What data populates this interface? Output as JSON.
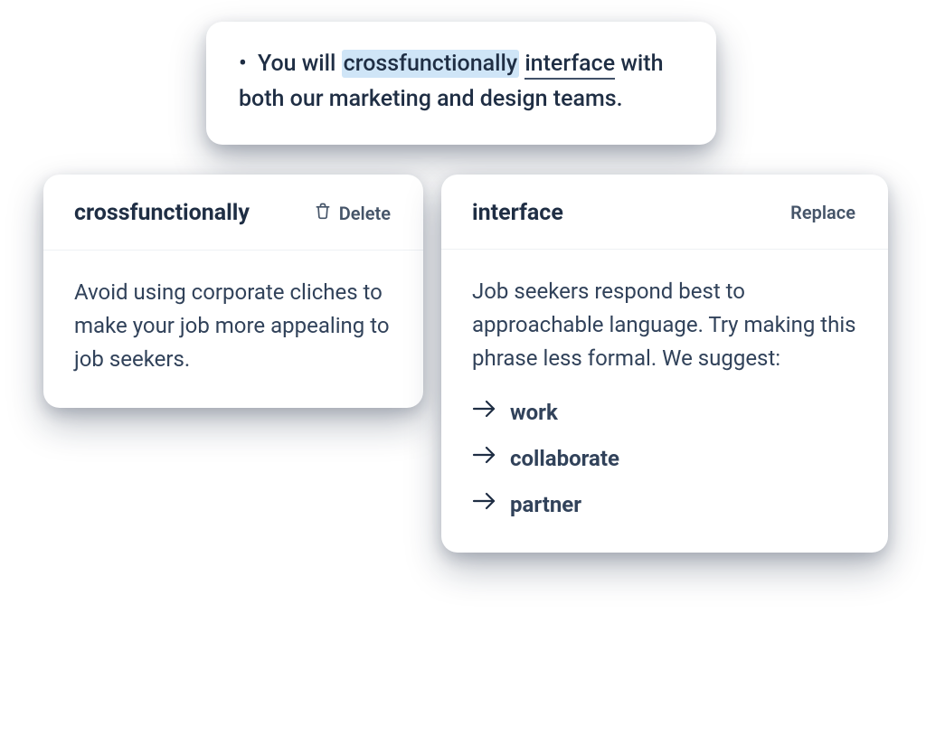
{
  "sentence": {
    "bullet": "•",
    "part1": "You will ",
    "highlighted": "crossfunctionally",
    "space": " ",
    "underlined": "interface",
    "part2": " with both our marketing and design teams."
  },
  "cards": {
    "left": {
      "title": "crossfunctionally",
      "action": "Delete",
      "body": "Avoid using corporate cliches to make your job more appealing to job seekers."
    },
    "right": {
      "title": "interface",
      "action": "Replace",
      "body": "Job seekers respond best to approachable language. Try making this phrase less formal. We suggest:",
      "suggestions": [
        "work",
        "collaborate",
        "partner"
      ]
    }
  }
}
